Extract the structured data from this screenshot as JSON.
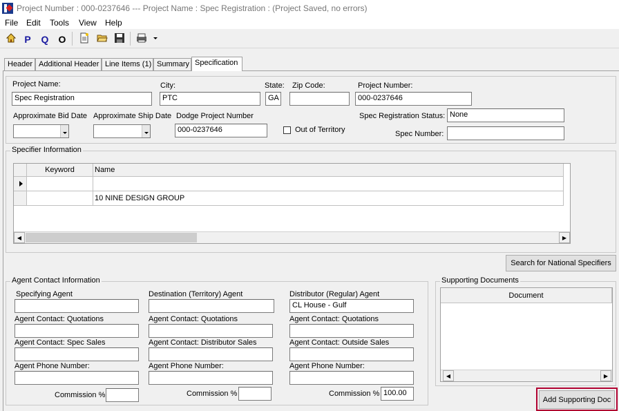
{
  "window": {
    "title": "Project Number : 000-0237646 --- Project Name : Spec Registration  : (Project Saved, no errors)"
  },
  "menu": [
    "File",
    "Edit",
    "Tools",
    "View",
    "Help"
  ],
  "toolbar": {
    "home_icon": "house-icon",
    "p_label": "P",
    "q_label": "Q",
    "o_label": "O",
    "new_icon": "new-document-icon",
    "open_icon": "open-folder-icon",
    "save_icon": "floppy-disk-icon",
    "print_icon": "printer-icon"
  },
  "tabs": [
    "Header",
    "Additional Header",
    "Line Items (1)",
    "Summary",
    "Specification"
  ],
  "project": {
    "name_label": "Project Name:",
    "name_value": "Spec Registration",
    "city_label": "City:",
    "city_value": "PTC",
    "state_label": "State:",
    "state_value": "GA",
    "zip_label": "Zip Code:",
    "zip_value": "",
    "number_label": "Project Number:",
    "number_value": "000-0237646",
    "bid_date_label": "Approximate Bid Date",
    "bid_date_value": "",
    "ship_date_label": "Approximate Ship Date",
    "ship_date_value": "",
    "dodge_label": "Dodge Project Number",
    "dodge_value": "000-0237646",
    "out_of_territory_label": "Out of Territory",
    "out_of_territory_checked": false,
    "spec_status_label": "Spec Registration Status:",
    "spec_status_value": "None",
    "spec_number_label": "Spec Number:",
    "spec_number_value": ""
  },
  "specifier": {
    "title": "Specifier Information",
    "columns": [
      "Keyword",
      "Name"
    ],
    "rows": [
      {
        "keyword": "",
        "name": ""
      },
      {
        "keyword": "",
        "name": "10 NINE DESIGN GROUP"
      }
    ],
    "search_button": "Search for National Specifiers"
  },
  "agent": {
    "title": "Agent Contact Information",
    "col1": {
      "agent_label": "Specifying Agent",
      "agent_value": "",
      "contact1_label": "Agent Contact: Quotations",
      "contact1_value": "",
      "contact2_label": "Agent Contact: Spec Sales",
      "contact2_value": "",
      "phone_label": "Agent Phone Number:",
      "phone_value": "",
      "commission_label": "Commission %",
      "commission_value": ""
    },
    "col2": {
      "agent_label": "Destination (Territory) Agent",
      "agent_value": "",
      "contact1_label": "Agent Contact: Quotations",
      "contact1_value": "",
      "contact2_label": "Agent Contact: Distributor Sales",
      "contact2_value": "",
      "phone_label": "Agent Phone Number:",
      "phone_value": "",
      "commission_label": "Commission %",
      "commission_value": ""
    },
    "col3": {
      "agent_label": "Distributor (Regular) Agent",
      "agent_value": "CL House - Gulf",
      "contact1_label": "Agent Contact: Quotations",
      "contact1_value": "",
      "contact2_label": "Agent Contact: Outside Sales",
      "contact2_value": "",
      "phone_label": "Agent Phone Number:",
      "phone_value": "",
      "commission_label": "Commission %",
      "commission_value": "100.00"
    }
  },
  "supporting": {
    "title": "Supporting Documents",
    "column": "Document",
    "add_button": "Add Supporting Doc"
  },
  "colors": {
    "highlight": "#b00030",
    "title_text": "#777777"
  }
}
